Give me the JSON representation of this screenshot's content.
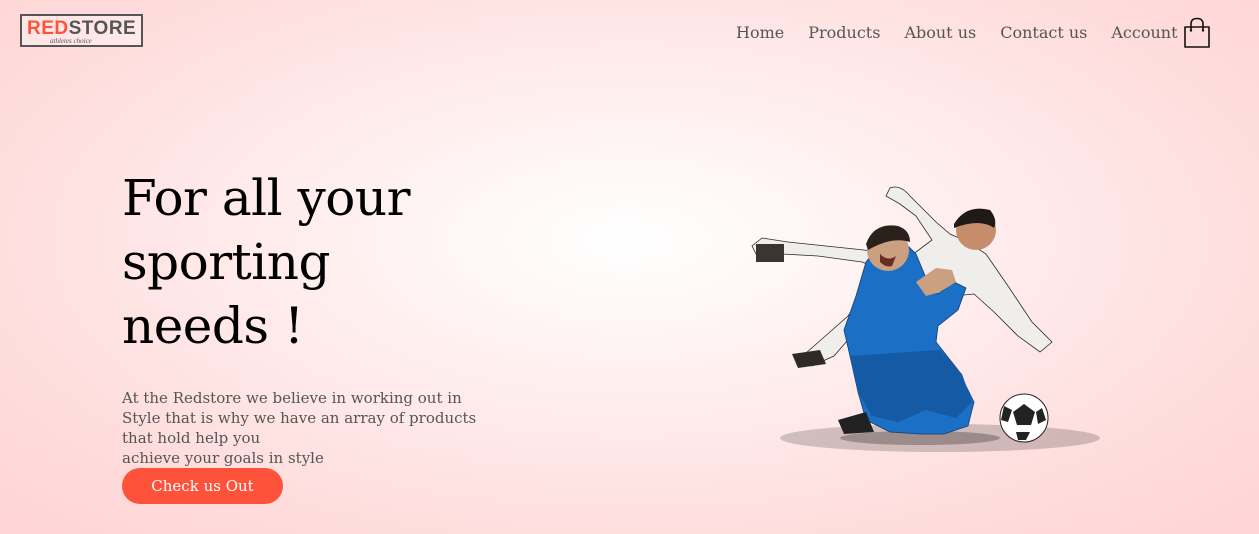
{
  "brand": {
    "logo_main": "STORE",
    "logo_accent": "RED",
    "tagline": "athletes choice"
  },
  "nav": {
    "items": [
      "Home",
      "Products",
      "About us",
      "Contact us",
      "Account"
    ],
    "cart_icon": "shopping-bag-icon"
  },
  "hero": {
    "title_lines": [
      "For all your",
      "sporting",
      "needs !"
    ],
    "description_lines": [
      "At the Redstore we believe in working out in",
      "Style that is why we have an array of products",
      "that hold help you",
      "achieve your goals in style"
    ],
    "button_label": "Check us Out",
    "image": "soccer-players-photo"
  },
  "colors": {
    "accent": "#ff523b",
    "text_muted": "#555555",
    "background": "#ffdcdc"
  }
}
